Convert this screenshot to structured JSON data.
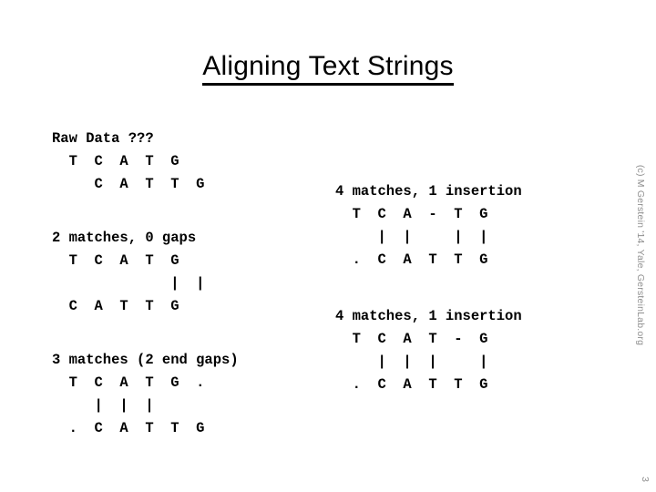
{
  "slide": {
    "title": "Aligning Text Strings",
    "page_number": "3",
    "credit": "(c) M Gerstein '14, Yale, GersteinLab.org",
    "text_color": "#000000",
    "background_color": "#ffffff",
    "credit_color": "#8f8f8f"
  },
  "left_column": {
    "blocks": [
      {
        "name": "raw-data",
        "header": "Raw Data ???",
        "top_seq": "  T  C  A  T  G",
        "bars": "",
        "bottom_seq": "     C  A  T  T  G"
      },
      {
        "name": "two-matches",
        "header": "2 matches, 0 gaps",
        "top_seq": "  T  C  A  T  G",
        "bars": "              |  |",
        "bottom_seq": "  C  A  T  T  G"
      },
      {
        "name": "three-matches",
        "header": "3 matches (2 end gaps)",
        "top_seq": "  T  C  A  T  G  .",
        "bars": "     |  |  |",
        "bottom_seq": "  .  C  A  T  T  G"
      }
    ]
  },
  "right_column": {
    "blocks": [
      {
        "name": "four-matches-insertion-a",
        "header": "4 matches, 1 insertion",
        "top_seq": "  T  C  A  -  T  G",
        "bars": "     |  |     |  |",
        "bottom_seq": "  .  C  A  T  T  G"
      },
      {
        "name": "four-matches-insertion-b",
        "header": "4 matches, 1 insertion",
        "top_seq": "  T  C  A  T  -  G",
        "bars": "     |  |  |     |",
        "bottom_seq": "  .  C  A  T  T  G"
      }
    ]
  }
}
